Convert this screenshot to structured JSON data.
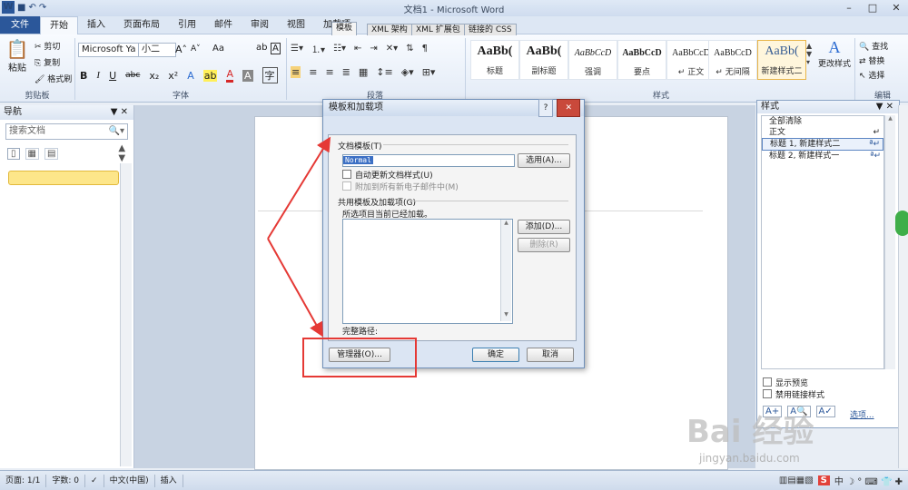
{
  "window": {
    "title": "文档1 - Microsoft Word",
    "logo": "W",
    "undo": "↶",
    "redo": "↷"
  },
  "tabs": [
    "文件",
    "开始",
    "插入",
    "页面布局",
    "引用",
    "邮件",
    "审阅",
    "视图",
    "加载项"
  ],
  "clipboard": {
    "paste": "粘贴",
    "cut": "剪切",
    "copy": "复制",
    "format_painter": "格式刷",
    "group": "剪贴板"
  },
  "font": {
    "name": "Microsoft Ya",
    "size": "小二",
    "group": "字体",
    "grow": "A",
    "shrink": "A",
    "case": "Aa",
    "bold": "B",
    "italic": "I",
    "underline": "U",
    "strike": "abc",
    "subscript": "x",
    "superscript": "x",
    "font_color": "A"
  },
  "paragraph": {
    "group": "段落"
  },
  "styles": {
    "group": "样式",
    "items": [
      {
        "sample": "AaBb(",
        "name": "标题"
      },
      {
        "sample": "AaBb(",
        "name": "副标题"
      },
      {
        "sample": "AaBbCcD",
        "name": "强调"
      },
      {
        "sample": "AaBbCcD",
        "name": "要点"
      },
      {
        "sample": "AaBbCcD",
        "name": "正文"
      },
      {
        "sample": "AaBbCcD",
        "name": "无间隔"
      },
      {
        "sample": "AaBb(",
        "name": "新建样式二"
      }
    ],
    "change": "更改样式"
  },
  "editing": {
    "group": "编辑",
    "find": "查找",
    "replace": "替换",
    "select": "选择"
  },
  "nav": {
    "title": "导航",
    "search_placeholder": "搜索文档"
  },
  "dialog": {
    "title": "模板和加载项",
    "tabs": [
      "模板",
      "XML 架构",
      "XML 扩展包",
      "链接的 CSS"
    ],
    "doc_template_label": "文档模板(T)",
    "template_value": "Normal",
    "choose_button": "选用(A)...",
    "auto_update": "自动更新文档样式(U)",
    "attach_email": "附加到所有新电子邮件中(M)",
    "global_label": "共用模板及加载项(G)",
    "loaded_note": "所选项目当前已经加载。",
    "add_button": "添加(D)...",
    "remove_button": "删除(R)",
    "full_path": "完整路径:",
    "organizer_button": "管理器(O)...",
    "ok_button": "确定",
    "cancel_button": "取消"
  },
  "style_pane": {
    "title": "样式",
    "items": [
      "全部清除",
      "正文",
      "标题 1, 新建样式二",
      "标题 2, 新建样式一"
    ],
    "show_preview": "显示预览",
    "disable_linked": "禁用链接样式",
    "options": "选项..."
  },
  "status": {
    "page": "页面: 1/1",
    "words": "字数: 0",
    "lang": "中文(中国)",
    "mode": "插入"
  },
  "watermark": {
    "brand": "Bai 经验",
    "url": "jingyan.baidu.com"
  },
  "colors": {
    "accent": "#2b579a",
    "arrow": "#e53935",
    "highlight": "#fde68a"
  }
}
